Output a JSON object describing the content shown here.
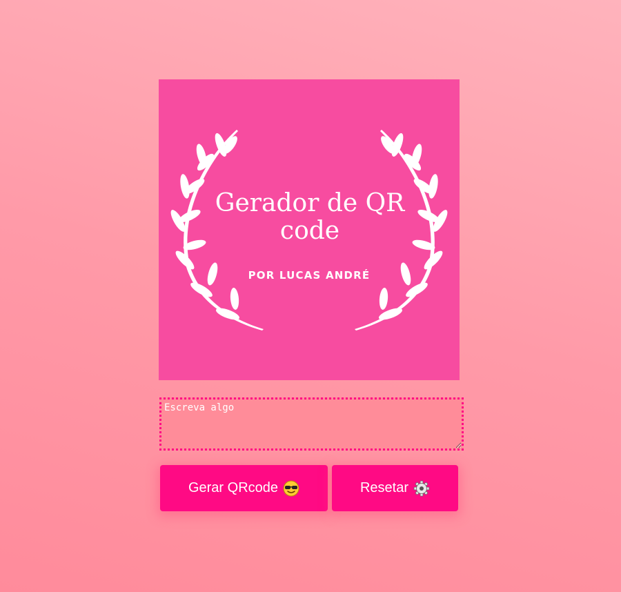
{
  "logo": {
    "title": "Gerador de QR code",
    "subtitle": "POR LUCAS ANDRÉ",
    "background_color": "#f74ca0"
  },
  "input": {
    "placeholder": "Escreva algo",
    "value": ""
  },
  "buttons": {
    "generate_label": "Gerar QRcode",
    "generate_icon": "sunglasses-emoji-icon",
    "reset_label": "Resetar",
    "reset_icon": "gear-icon",
    "color": "#ff0a84"
  }
}
